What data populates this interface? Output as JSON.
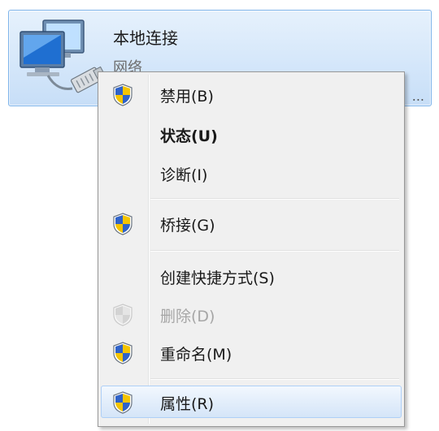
{
  "adapter": {
    "name": "本地连接",
    "status": "网络",
    "device": "..."
  },
  "context_menu": {
    "items": [
      {
        "label": "禁用(B)",
        "shield": true
      },
      {
        "label": "状态(U)",
        "shield": false,
        "bold": true
      },
      {
        "label": "诊断(I)",
        "shield": false
      },
      {
        "label": "桥接(G)",
        "shield": true
      },
      {
        "label": "创建快捷方式(S)",
        "shield": false
      },
      {
        "label": "删除(D)",
        "shield": true,
        "disabled": true
      },
      {
        "label": "重命名(M)",
        "shield": true
      },
      {
        "label": "属性(R)",
        "shield": true,
        "highlighted": true
      }
    ]
  },
  "colors": {
    "selection_border": "#7eb4ea",
    "selection_fill": "#d5e7fa",
    "menu_background": "#f0f0f0",
    "shield_blue": "#2f63c9",
    "shield_yellow": "#f5c400",
    "disabled_text": "#a6a6a6"
  },
  "icons": {
    "adapter": "network-adapter-icon",
    "uac": "uac-shield-icon"
  }
}
